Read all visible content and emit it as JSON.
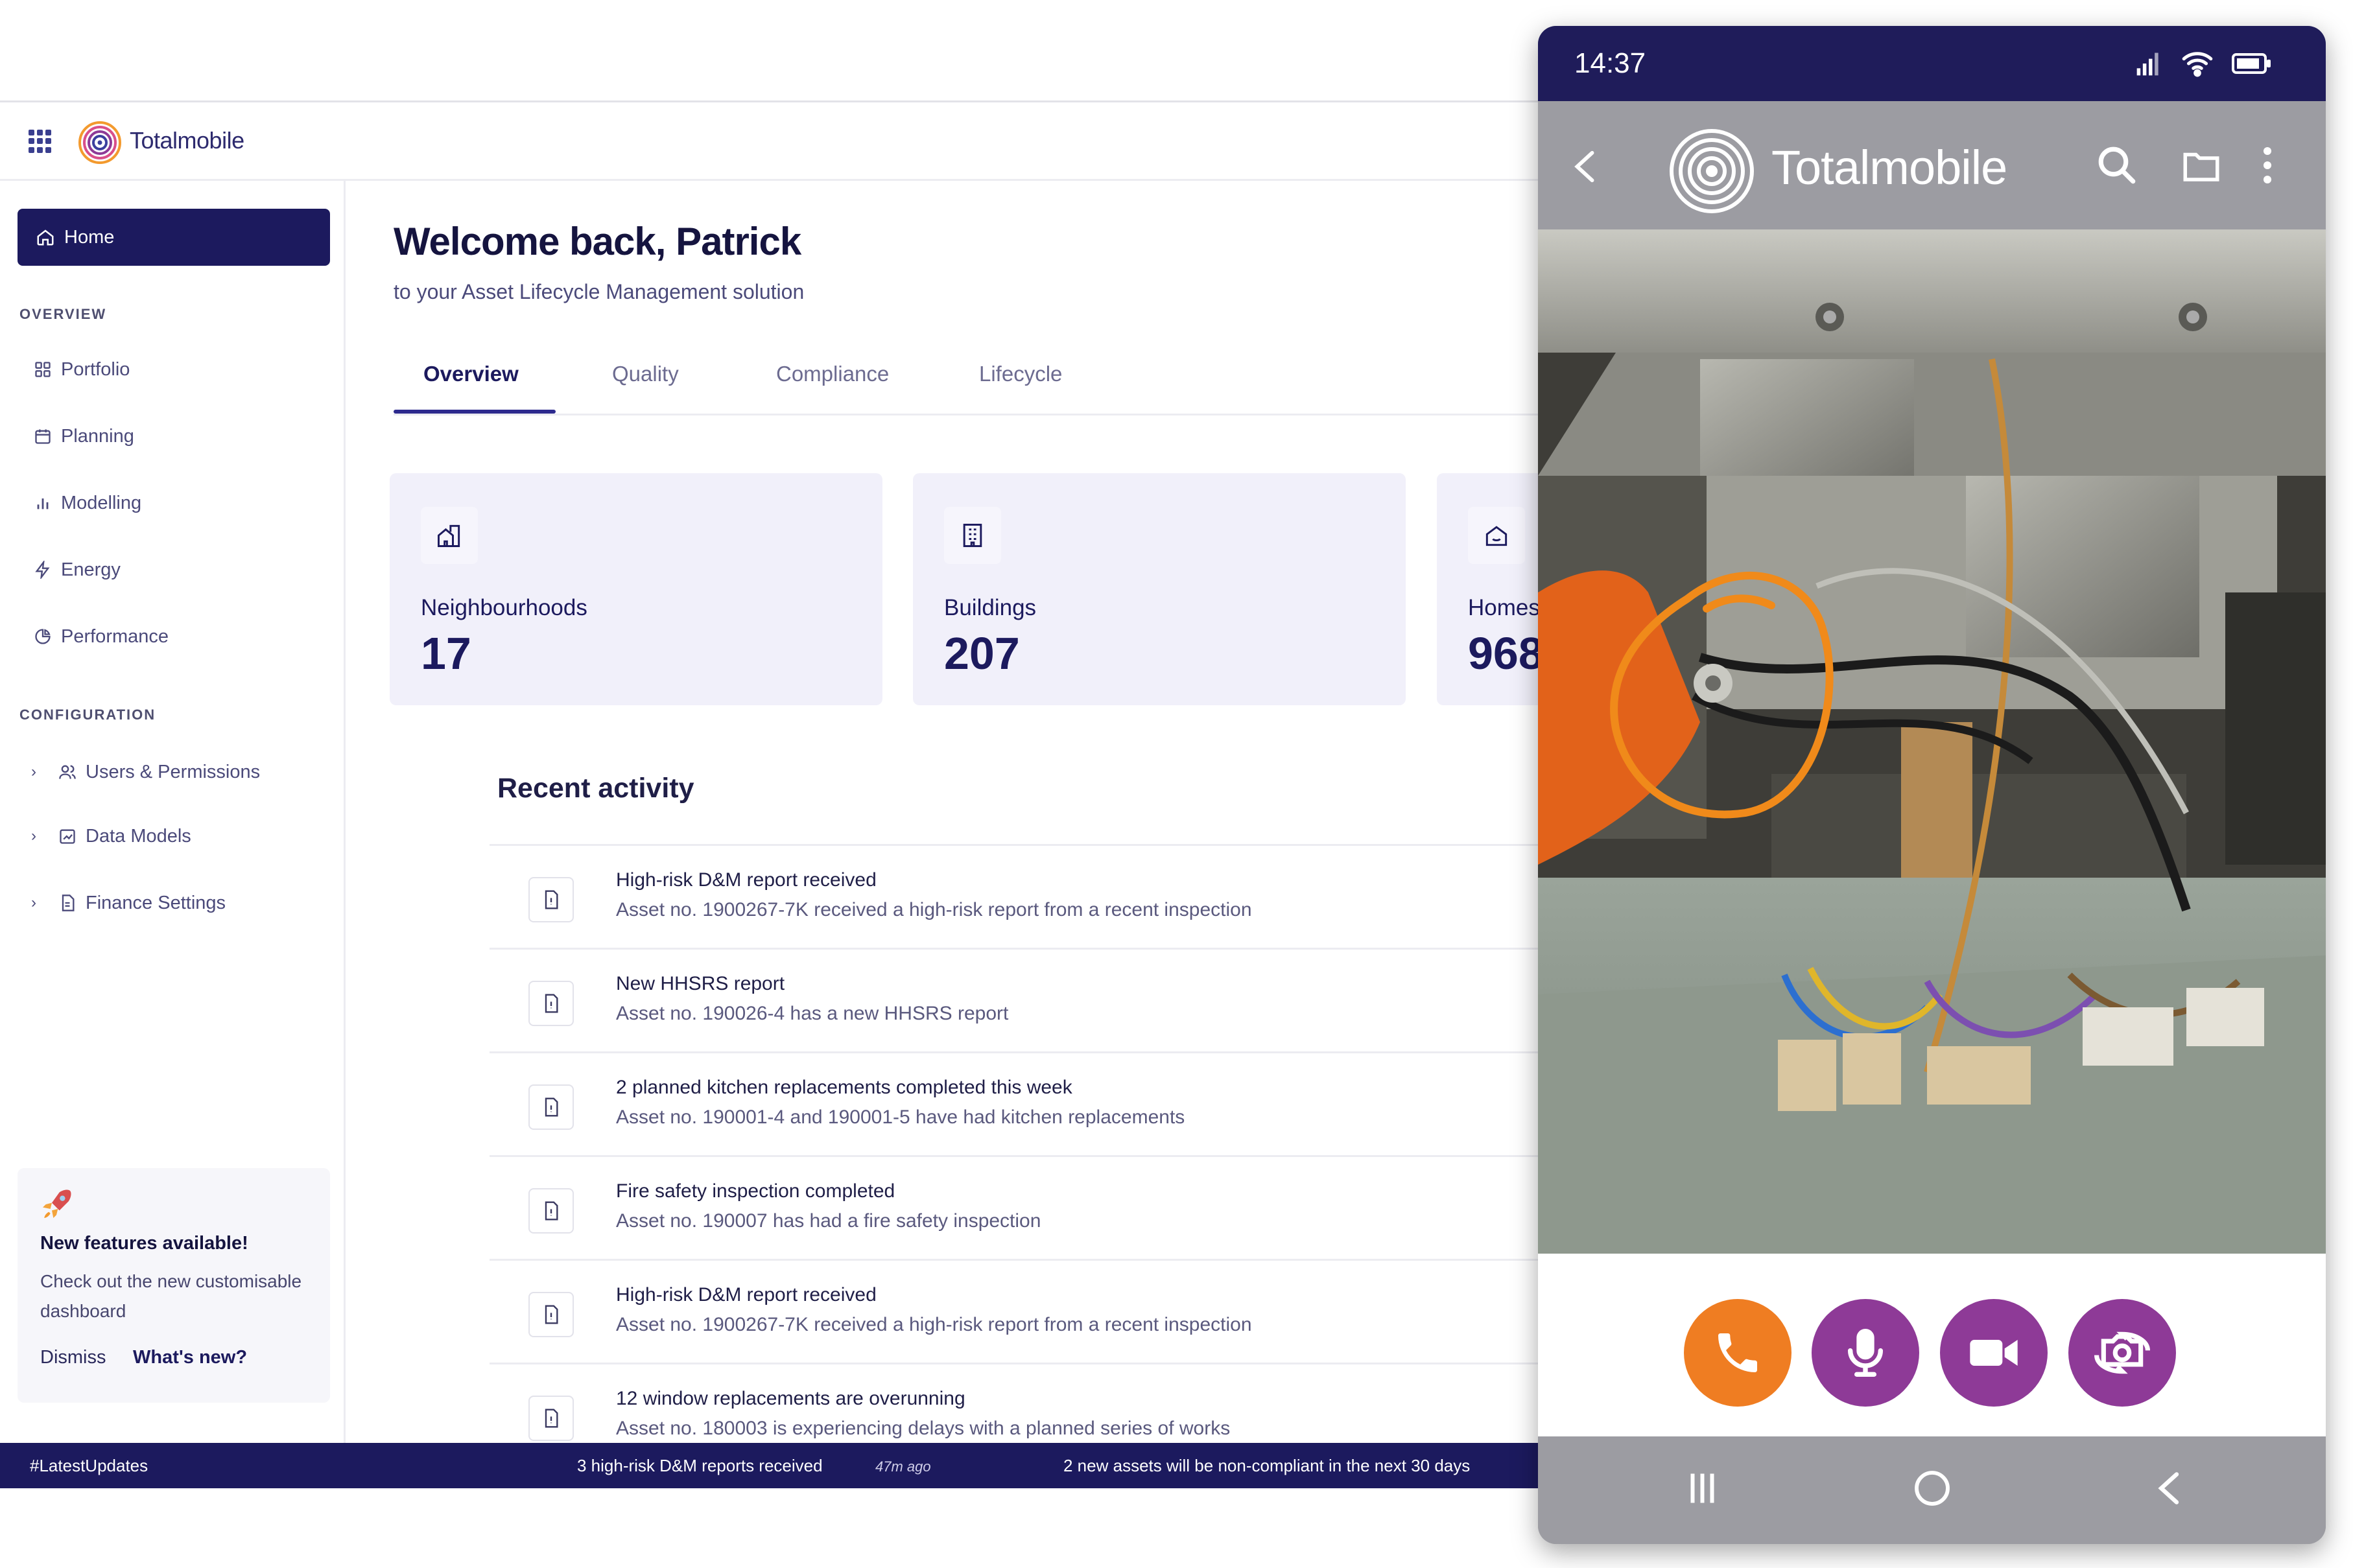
{
  "app": {
    "logo_text": "Totalmobile"
  },
  "sidebar": {
    "home": "Home",
    "overview_heading": "OVERVIEW",
    "overview_items": [
      "Portfolio",
      "Planning",
      "Modelling",
      "Energy",
      "Performance"
    ],
    "config_heading": "CONFIGURATION",
    "config_items": [
      "Users & Permissions",
      "Data Models",
      "Finance Settings"
    ]
  },
  "promo": {
    "title": "New features available!",
    "body": "Check out the new customisable dashboard",
    "dismiss": "Dismiss",
    "whats_new": "What's new?"
  },
  "main": {
    "welcome": "Welcome back, Patrick",
    "subtitle": "to your Asset Lifecycle Management solution",
    "tabs": [
      "Overview",
      "Quality",
      "Compliance",
      "Lifecycle"
    ],
    "active_tab": "Overview",
    "stats": [
      {
        "label": "Neighbourhoods",
        "value": "17",
        "icon": "neighbourhood-icon"
      },
      {
        "label": "Buildings",
        "value": "207",
        "icon": "building-icon"
      },
      {
        "label": "Homes",
        "value": "968",
        "icon": "home-icon"
      }
    ],
    "recent_title": "Recent activity",
    "activity": [
      {
        "title": "High-risk D&M report received",
        "desc": "Asset no. 1900267-7K received a high-risk report from a recent inspection"
      },
      {
        "title": "New HHSRS report",
        "desc": "Asset no. 190026-4 has a new HHSRS report"
      },
      {
        "title": "2 planned kitchen replacements completed this week",
        "desc": "Asset no. 190001-4 and 190001-5 have had kitchen replacements"
      },
      {
        "title": "Fire safety inspection completed",
        "desc": "Asset no. 190007 has had a fire safety inspection"
      },
      {
        "title": "High-risk D&M report received",
        "desc": "Asset no. 1900267-7K received a high-risk report from a recent inspection"
      },
      {
        "title": "12 window replacements are overunning",
        "desc": "Asset no. 180003 is experiencing delays with a planned series of works"
      }
    ]
  },
  "ticker": {
    "tag": "#LatestUpdates",
    "item1": "3 high-risk D&M reports received",
    "item1_time": "47m ago",
    "item2": "2 new assets will be non-compliant in the next 30 days"
  },
  "phone": {
    "time": "14:37",
    "logo_text": "Totalmobile",
    "call_buttons": [
      "phone-icon",
      "microphone-icon",
      "video-camera-icon",
      "switch-camera-icon"
    ],
    "colors": {
      "call": "#ef7d22",
      "action": "#8e3a97",
      "status_bar": "#1f1c5a"
    }
  }
}
